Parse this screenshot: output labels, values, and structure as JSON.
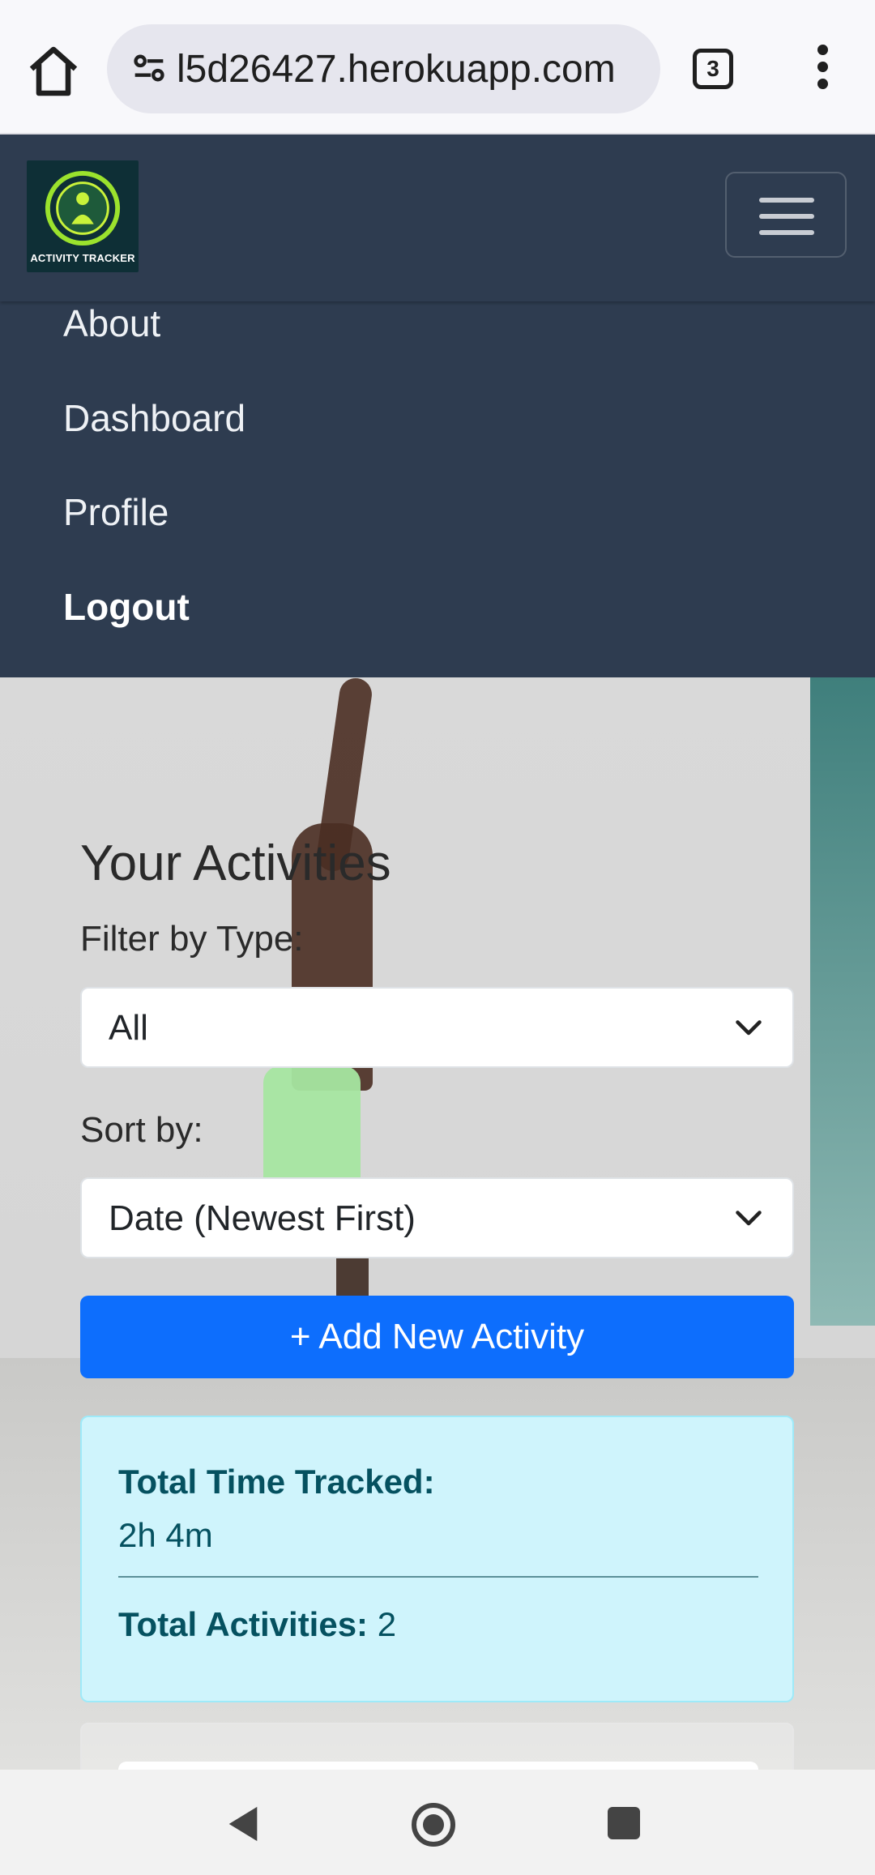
{
  "browser": {
    "url": "l5d26427.herokuapp.com",
    "tab_count": "3"
  },
  "navbar": {
    "logo_text": "ACTIVITY TRACKER",
    "links": [
      {
        "label": "About"
      },
      {
        "label": "Dashboard"
      },
      {
        "label": "Profile"
      },
      {
        "label": "Logout"
      }
    ]
  },
  "main": {
    "heading": "Your Activities",
    "filter_label": "Filter by Type:",
    "filter_value": "All",
    "sort_label": "Sort by:",
    "sort_value": "Date (Newest First)",
    "add_button": "+ Add New Activity",
    "stats": {
      "time_label": "Total Time Tracked:",
      "time_value": "2h 4m",
      "activities_label": "Total Activities:",
      "activities_value": "2"
    }
  },
  "colors": {
    "navbar": "#2e3c50",
    "primary": "#0d6efd",
    "info_bg": "#cff4fc",
    "info_text": "#055160"
  }
}
